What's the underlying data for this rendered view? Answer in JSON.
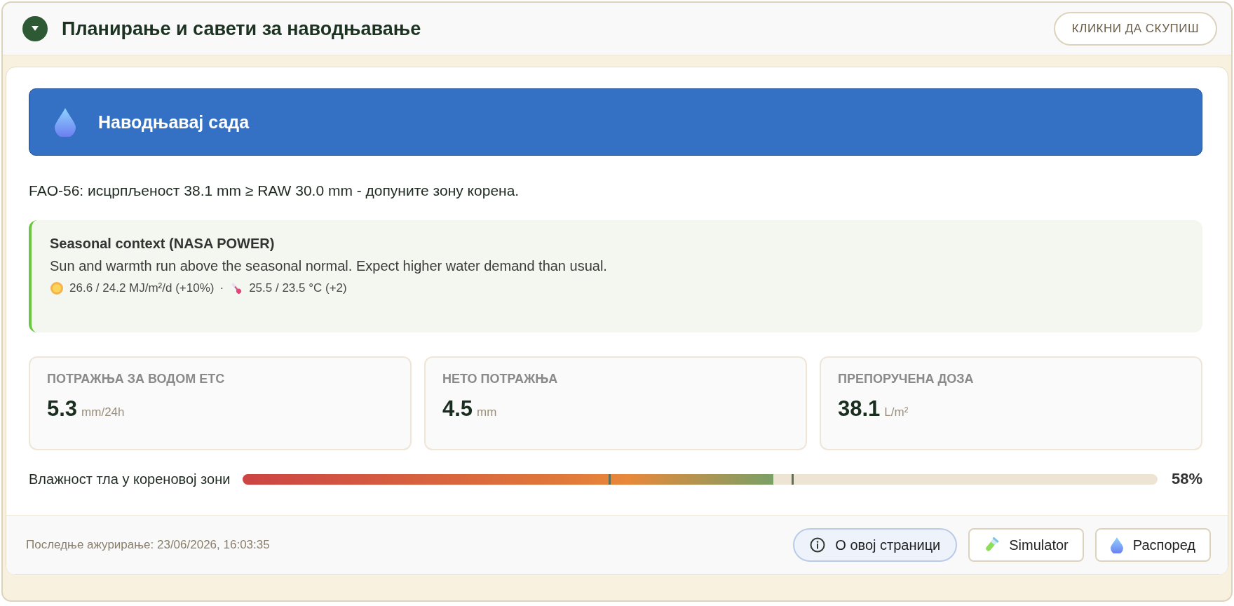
{
  "header": {
    "title": "Планирање и савети за наводњавање",
    "expanded": true,
    "collapse_button": "КЛИКНИ ДА СКУПИШ"
  },
  "alert": {
    "kind": "action",
    "title": "Наводњавај сада"
  },
  "description": "FAO-56: исцрпљеност 38.1 mm ≥ RAW 30.0 mm - допуните зону корена.",
  "seasonal": {
    "title": "Seasonal context (NASA POWER)",
    "text": "Sun and warmth run above the seasonal normal. Expect higher water demand than usual.",
    "stats": [
      {
        "kind": "sun",
        "text": "26.6 / 24.2 MJ/m²/d (+10%)"
      },
      {
        "kind": "thermometer",
        "text": "25.5 / 23.5 °C (+2)"
      }
    ],
    "separator": "·"
  },
  "metrics": [
    {
      "label": "ПОТРАЖЊА ЗА ВОДОМ ETC",
      "value": "5.3",
      "unit": "mm/24h"
    },
    {
      "label": "НЕТО ПОТРАЖЊА",
      "value": "4.5",
      "unit": "mm"
    },
    {
      "label": "ПРЕПОРУЧЕНА ДОЗА",
      "value": "38.1",
      "unit": "L/m²"
    }
  ],
  "moisture": {
    "label": "Влажност тла у кореновој зони",
    "level": 0.58,
    "reading": "58%",
    "thresholds": [
      {
        "level": 0.4
      },
      {
        "level": 0.6
      }
    ]
  },
  "footer": {
    "updated": "Последње ажурирање: 23/06/2026, 16:03:35",
    "buttons": [
      {
        "kind": "info",
        "label": "О овој страници"
      },
      {
        "kind": "tube",
        "label": "Simulator"
      },
      {
        "kind": "drop",
        "label": "Распоред"
      }
    ]
  }
}
